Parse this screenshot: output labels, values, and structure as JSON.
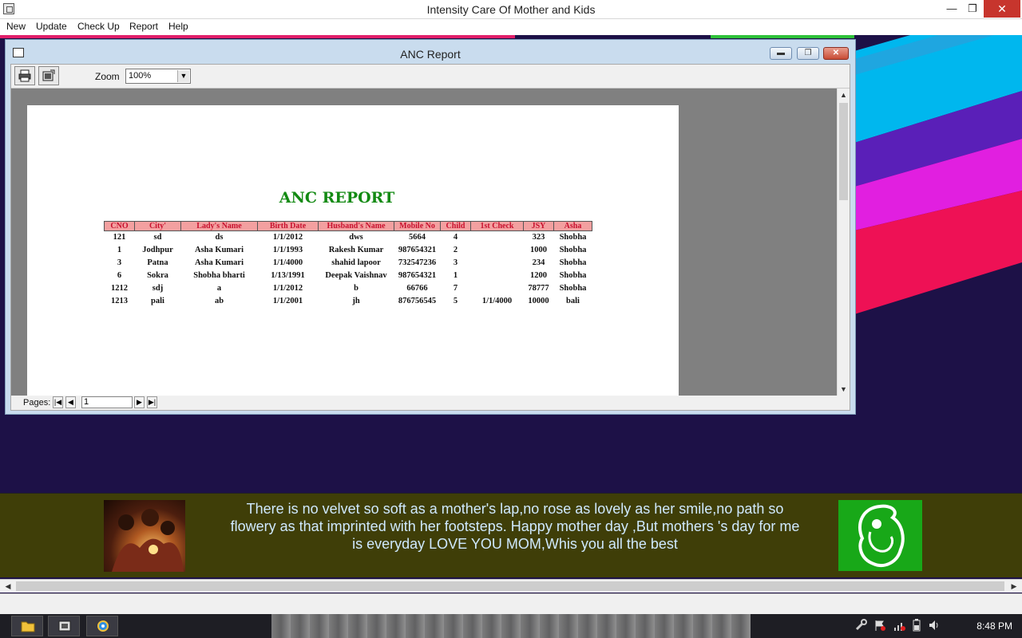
{
  "app": {
    "title": "Intensity Care Of Mother and Kids",
    "controls": {
      "minimize": "—",
      "restore": "❐",
      "close": "✕"
    }
  },
  "menu": [
    "New",
    "Update",
    "Check Up",
    "Report",
    "Help"
  ],
  "child_window": {
    "title": "ANC Report",
    "controls": {
      "minimize": "▬",
      "restore": "❐",
      "close": "✕"
    }
  },
  "viewer": {
    "zoom_label": "Zoom",
    "zoom_value": "100%",
    "pages_label": "Pages:",
    "page_value": "1"
  },
  "report": {
    "title": "ANC REPORT",
    "headers": [
      "CNO",
      "City'",
      "Lady's Name",
      "Birth Date",
      "Husband's Name",
      "Mobile No",
      "Child",
      "1st Check",
      "JSY",
      "Asha"
    ],
    "rows": [
      [
        "121",
        "sd",
        "ds",
        "1/1/2012",
        "dws",
        "5664",
        "4",
        "",
        "323",
        "Shobha"
      ],
      [
        "1",
        "Jodhpur",
        "Asha Kumari",
        "1/1/1993",
        "Rakesh Kumar",
        "987654321",
        "2",
        "",
        "1000",
        "Shobha"
      ],
      [
        "3",
        "Patna",
        "Asha Kumari",
        "1/1/4000",
        "shahid lapoor",
        "732547236",
        "3",
        "",
        "234",
        "Shobha"
      ],
      [
        "6",
        "Sokra",
        "Shobha bharti",
        "1/13/1991",
        "Deepak Vaishnav",
        "987654321",
        "1",
        "",
        "1200",
        "Shobha"
      ],
      [
        "1212",
        "sdj",
        "a",
        "1/1/2012",
        "b",
        "66766",
        "7",
        "",
        "78777",
        "Shobha"
      ],
      [
        "1213",
        "pali",
        "ab",
        "1/1/2001",
        "jh",
        "876756545",
        "5",
        "1/1/4000",
        "10000",
        "bali"
      ]
    ]
  },
  "banner": {
    "quote": "There is no velvet so soft as a mother's lap,no rose as lovely as her smile,no path so flowery as that imprinted with her footsteps. Happy mother day ,But mothers 's day for me is everyday LOVE YOU MOM,Whis you all the best"
  },
  "taskbar": {
    "clock": "8:48 PM"
  },
  "colors": {
    "accent_green": "#138a13",
    "header_pink": "#f3a0a0",
    "header_text": "#c8102e",
    "banner_bg": "#3f3e08",
    "desktop_bg": "#1d1147"
  }
}
